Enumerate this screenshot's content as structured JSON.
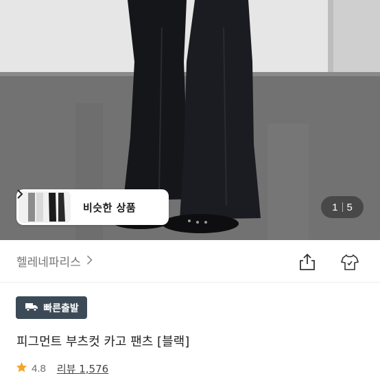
{
  "gallery": {
    "similar_label": "비슷한 상품",
    "page_current": "1",
    "page_total": "5"
  },
  "seller": {
    "name": "헬레네파리스"
  },
  "product": {
    "badge_label": "빠른출발",
    "title": "피그먼트 부츠컷 카고 팬츠 [블랙]",
    "rating": "4.8",
    "review_label": "리뷰",
    "review_count": "1,576"
  },
  "icons": [
    "chevron-right-icon",
    "share-icon",
    "wishlist-shirt-icon",
    "truck-icon",
    "star-icon"
  ],
  "colors": {
    "badge_bg": "#3c4a57",
    "star": "#f5a524",
    "text_primary": "#222222",
    "text_secondary": "#757575"
  }
}
